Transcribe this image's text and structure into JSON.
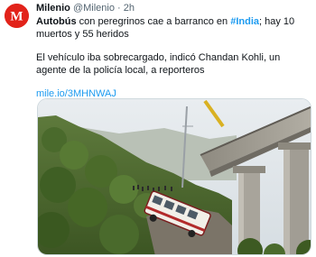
{
  "tweet": {
    "author": {
      "display_name": "Milenio",
      "handle": "@Milenio",
      "separator": "·",
      "time": "2h",
      "avatar_letter": "M",
      "avatar_color": "#e2231a"
    },
    "headline": {
      "bold_lead": "Autobús",
      "text_before_hashtag": " con peregrinos cae a barranco en ",
      "hashtag": "#India",
      "text_after_hashtag": "; hay 10 muertos y 55 heridos"
    },
    "body": "El vehículo iba sobrecargado, indicó Chandan Kohli, un agente de la policía local, a reporteros",
    "link": "mile.io/3MHNWAJ",
    "media": {
      "description_icon": "photo-icon"
    }
  },
  "colors": {
    "link": "#1d9bf0",
    "text": "#0f1419",
    "secondary": "#536471",
    "border": "#cfd9de"
  }
}
